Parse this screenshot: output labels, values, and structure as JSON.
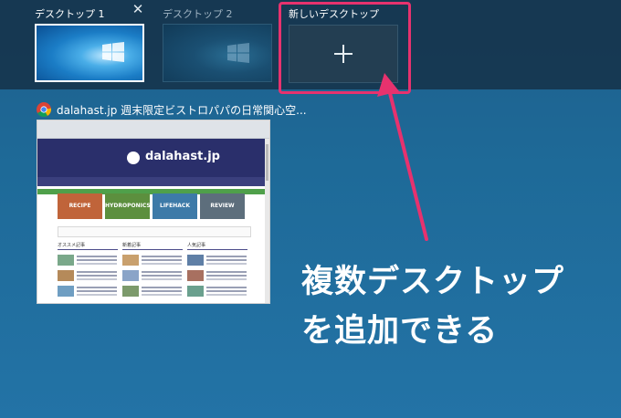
{
  "desktops": [
    {
      "label": "デスクトップ 1",
      "active": true
    },
    {
      "label": "デスクトップ 2",
      "active": false
    }
  ],
  "new_desktop": {
    "label": "新しいデスクトップ",
    "icon": "plus-icon"
  },
  "window": {
    "title": "dalahast.jp 週末限定ビストロパパの日常関心空...",
    "app_icon": "chrome-icon",
    "page": {
      "site_title": "dalahast.jp",
      "cards": [
        "RECIPE",
        "HYDROPONICS",
        "LIFEHACK",
        "REVIEW"
      ],
      "columns": [
        "オススメ記事",
        "新着記事",
        "人気記事"
      ]
    }
  },
  "annotation": {
    "line1": "複数デスクトップ",
    "line2": "を追加できる",
    "color": "#e7326e"
  }
}
